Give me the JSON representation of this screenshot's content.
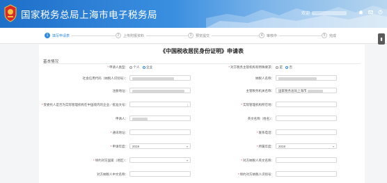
{
  "header": {
    "site_title": "国家税务总局上海市电子税务局",
    "user_prefix": "欢迎",
    "brand_color": "#1d6fc8"
  },
  "steps": [
    {
      "num": "1",
      "label": "填写申请表",
      "active": true
    },
    {
      "num": "2",
      "label": "上传附报资料",
      "active": false
    },
    {
      "num": "3",
      "label": "预览提交",
      "active": false
    },
    {
      "num": "4",
      "label": "审核中",
      "active": false
    },
    {
      "num": "5",
      "label": "完成",
      "active": false
    }
  ],
  "form": {
    "title": "《中国税收居民身份证明》申请表",
    "section": "基本情况",
    "applicant_type": {
      "label": "申请人类型",
      "options": [
        "个人",
        "企业"
      ],
      "selected": "企业"
    },
    "other_party_req": {
      "label": "对方税务主管机构有特殊要求",
      "options": [
        "是",
        "否"
      ],
      "selected": "否"
    },
    "credit_code": {
      "label": "社会信用代码（纳税人识别号）"
    },
    "taxpayer_name": {
      "label": "纳税人名称"
    },
    "reg_address": {
      "label": "注册地址"
    },
    "tax_authority": {
      "label": "主管税务机关名称",
      "value": "国家税务总局上海市"
    },
    "entrusted_by": {
      "label": "受委托人是否为实际管理机构在中国境内的企业／批准文号"
    },
    "actual_mgmt": {
      "label": "实际管理机构所在地"
    },
    "applicant_name": {
      "label": "申请人"
    },
    "english_name": {
      "label": "英文名称（姓名）"
    },
    "mail_address": {
      "label": "通讯地址"
    },
    "phone": {
      "label": "联系电话"
    },
    "apply_year": {
      "label": "申请年度",
      "value": "2019"
    },
    "tax_year": {
      "label": "所属年度",
      "value": "2019"
    },
    "treaty_country": {
      "label": "缔约对方国家（地区）"
    },
    "treaty_taxpayer": {
      "label": "对方纳税人英文名称"
    },
    "treaty_cn_name": {
      "label": "对方纳税人中文名称"
    },
    "treaty_id": {
      "label": "缔约对方纳税人识别号"
    }
  }
}
